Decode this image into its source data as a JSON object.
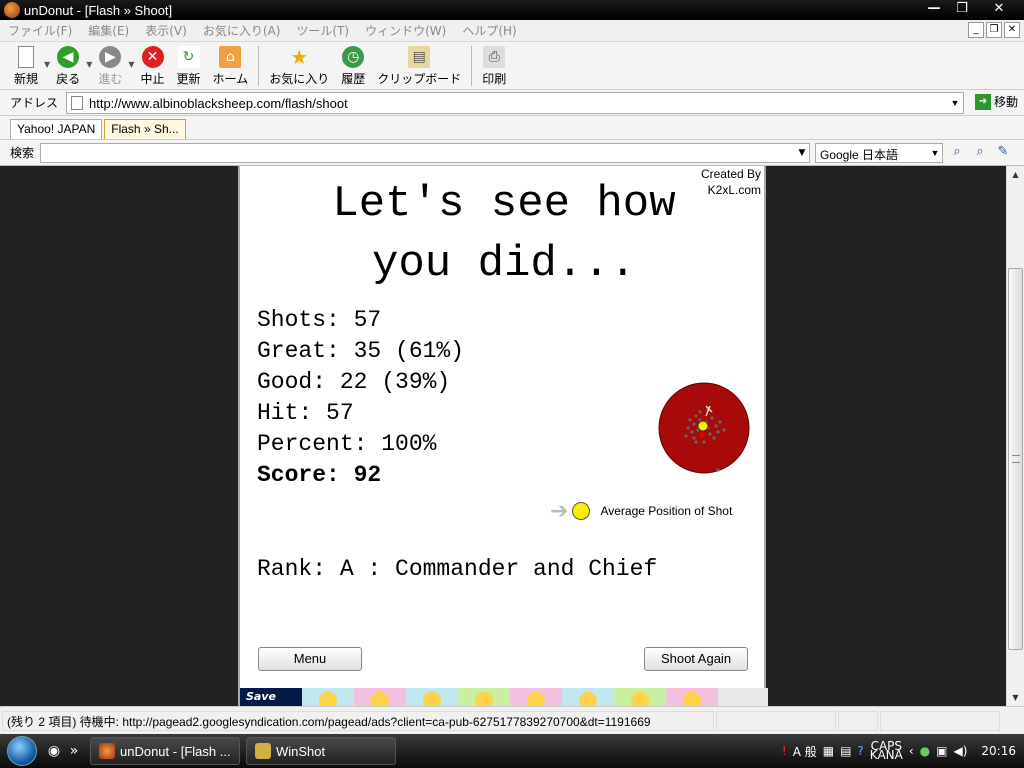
{
  "window": {
    "title": "unDonut - [Flash » Shoot]",
    "buttons": [
      "—",
      "❐",
      "✕"
    ]
  },
  "menu": [
    "ファイル(F)",
    "編集(E)",
    "表示(V)",
    "お気に入り(A)",
    "ツール(T)",
    "ウィンドウ(W)",
    "ヘルプ(H)"
  ],
  "toolbar": {
    "new": "新規",
    "back": "戻る",
    "forward": "進む",
    "stop": "中止",
    "refresh": "更新",
    "home": "ホーム",
    "favorites": "お気に入り",
    "history": "履歴",
    "clipboard": "クリップボード",
    "print": "印刷"
  },
  "address": {
    "label": "アドレス",
    "url": "http://www.albinoblacksheep.com/flash/shoot",
    "go": "移動"
  },
  "tabs": [
    "Yahoo! JAPAN",
    "Flash » Sh..."
  ],
  "search": {
    "label": "検索",
    "engine": "Google 日本語"
  },
  "flash": {
    "credit_line1": "Created By",
    "credit_line2": "K2xL.com",
    "heading_line1": "Let's see how",
    "heading_line2": "you did...",
    "stats": {
      "shots": "Shots: 57",
      "great": "Great: 35 (61%)",
      "good": "Good: 22 (39%)",
      "hit": "Hit: 57",
      "percent": "Percent: 100%",
      "score": "Score: 92"
    },
    "legend": "Average Position of Shot",
    "rank": "Rank: A : Commander and Chief",
    "menu_button": "Menu",
    "again_button": "Shoot Again",
    "ad_save": "Save"
  },
  "status": {
    "text": "(残り 2 項目) 待機中: http://pagead2.googlesyndication.com/pagead/ads?client=ca-pub-6275177839270700&dt=1191669"
  },
  "taskbar": {
    "tasks": [
      "unDonut - [Flash ...",
      "WinShot"
    ],
    "ime": "A 般",
    "caps": "CAPS",
    "kana": "KANA",
    "clock": "20:16"
  },
  "colors": {
    "target_outer": "#a80a0a",
    "avg_dot": "#ffee00"
  }
}
